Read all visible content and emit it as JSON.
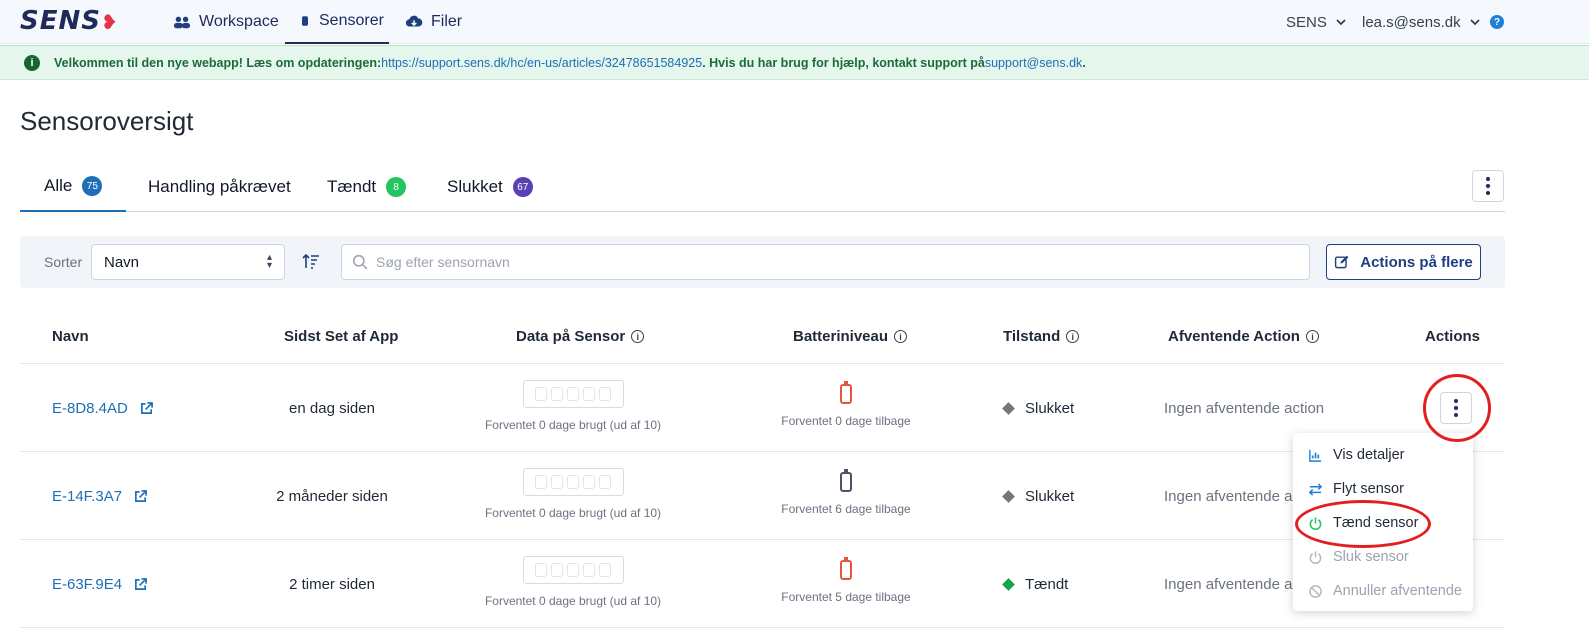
{
  "header": {
    "logo_text": "SENS",
    "nav": [
      {
        "label": "Workspace",
        "icon": "users-gear-icon"
      },
      {
        "label": "Sensorer",
        "icon": "sensor-icon"
      },
      {
        "label": "Filer",
        "icon": "cloud-download-icon"
      }
    ],
    "org_label": "SENS",
    "user_label": "lea.s@sens.dk",
    "help_label": "?"
  },
  "banner": {
    "text_before": "Velkommen til den nye webapp! Læs om opdateringen: ",
    "link_url_text": "https://support.sens.dk/hc/en-us/articles/32478651584925",
    "text_middle": ". Hvis du har brug for hjælp, kontakt support på ",
    "email_text": "support@sens.dk",
    "text_after": "."
  },
  "page": {
    "title": "Sensoroversigt"
  },
  "tabs": [
    {
      "label": "Alle",
      "count": "75",
      "color": "#1d6fb8"
    },
    {
      "label": "Handling påkrævet",
      "count": "",
      "color": ""
    },
    {
      "label": "Tændt",
      "count": "8",
      "color": "#22c55e"
    },
    {
      "label": "Slukket",
      "count": "67",
      "color": "#5b3fb5"
    }
  ],
  "filters": {
    "sort_label": "Sorter",
    "sort_value": "Navn",
    "search_placeholder": "Søg efter sensornavn",
    "bulk_actions_label": "Actions på flere"
  },
  "table": {
    "headers": [
      "Navn",
      "Sidst Set af App",
      "Data på Sensor",
      "Batteriniveau",
      "Tilstand",
      "Afventende Action",
      "Actions"
    ],
    "rows": [
      {
        "name": "E-8D8.4AD",
        "last_seen": "en dag siden",
        "data_note": "Forventet 0 dage brugt (ud af 10)",
        "battery_note": "Forventet 0 dage tilbage",
        "battery_color": "#e8553d",
        "state": "Slukket",
        "state_color": "#777777",
        "pending": "Ingen afventende action"
      },
      {
        "name": "E-14F.3A7",
        "last_seen": "2 måneder siden",
        "data_note": "Forventet 0 dage brugt (ud af 10)",
        "battery_note": "Forventet 6 dage tilbage",
        "battery_color": "#4b5563",
        "state": "Slukket",
        "state_color": "#777777",
        "pending": "Ingen afventende action"
      },
      {
        "name": "E-63F.9E4",
        "last_seen": "2 timer siden",
        "data_note": "Forventet 0 dage brugt (ud af 10)",
        "battery_note": "Forventet 5 dage tilbage",
        "battery_color": "#e8553d",
        "state": "Tændt",
        "state_color": "#16a34a",
        "pending": "Ingen afventende action"
      }
    ]
  },
  "context_menu": {
    "items": [
      {
        "label": "Vis detaljer",
        "icon": "bar-chart-icon",
        "enabled": true
      },
      {
        "label": "Flyt sensor",
        "icon": "swap-arrows-icon",
        "enabled": true
      },
      {
        "label": "Tænd sensor",
        "icon": "power-on-icon",
        "enabled": true
      },
      {
        "label": "Sluk sensor",
        "icon": "power-off-icon",
        "enabled": false
      },
      {
        "label": "Annuller afventende",
        "icon": "cancel-icon",
        "enabled": false
      }
    ]
  }
}
